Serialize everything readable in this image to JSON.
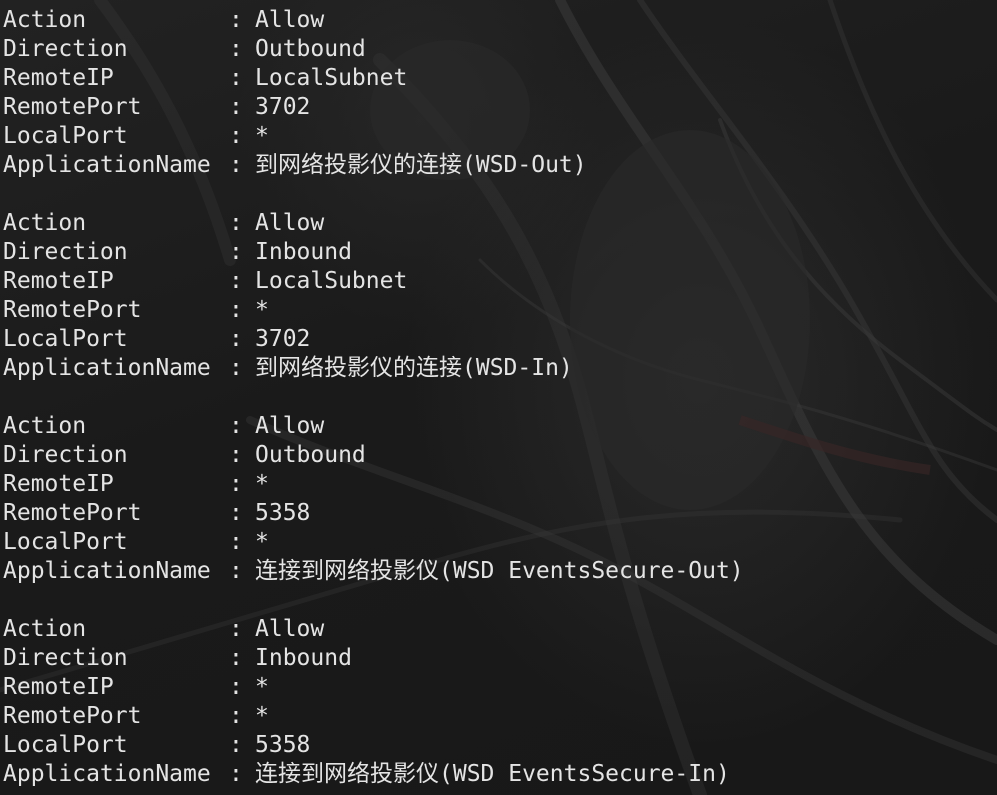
{
  "terminal": {
    "records": [
      {
        "fields": [
          {
            "key": "Action",
            "sep": ":",
            "value": "Allow"
          },
          {
            "key": "Direction",
            "sep": ":",
            "value": "Outbound"
          },
          {
            "key": "RemoteIP",
            "sep": ":",
            "value": "LocalSubnet"
          },
          {
            "key": "RemotePort",
            "sep": ":",
            "value": "3702"
          },
          {
            "key": "LocalPort",
            "sep": ":",
            "value": "*"
          },
          {
            "key": "ApplicationName",
            "sep": ":",
            "value": "到网络投影仪的连接(WSD-Out)"
          }
        ]
      },
      {
        "fields": [
          {
            "key": "Action",
            "sep": ":",
            "value": "Allow"
          },
          {
            "key": "Direction",
            "sep": ":",
            "value": "Inbound"
          },
          {
            "key": "RemoteIP",
            "sep": ":",
            "value": "LocalSubnet"
          },
          {
            "key": "RemotePort",
            "sep": ":",
            "value": "*"
          },
          {
            "key": "LocalPort",
            "sep": ":",
            "value": "3702"
          },
          {
            "key": "ApplicationName",
            "sep": ":",
            "value": "到网络投影仪的连接(WSD-In)"
          }
        ]
      },
      {
        "fields": [
          {
            "key": "Action",
            "sep": ":",
            "value": "Allow"
          },
          {
            "key": "Direction",
            "sep": ":",
            "value": "Outbound"
          },
          {
            "key": "RemoteIP",
            "sep": ":",
            "value": "*"
          },
          {
            "key": "RemotePort",
            "sep": ":",
            "value": "5358"
          },
          {
            "key": "LocalPort",
            "sep": ":",
            "value": "*"
          },
          {
            "key": "ApplicationName",
            "sep": ":",
            "value": "连接到网络投影仪(WSD EventsSecure-Out)"
          }
        ]
      },
      {
        "fields": [
          {
            "key": "Action",
            "sep": ":",
            "value": "Allow"
          },
          {
            "key": "Direction",
            "sep": ":",
            "value": "Inbound"
          },
          {
            "key": "RemoteIP",
            "sep": ":",
            "value": "*"
          },
          {
            "key": "RemotePort",
            "sep": ":",
            "value": "*"
          },
          {
            "key": "LocalPort",
            "sep": ":",
            "value": "5358"
          },
          {
            "key": "ApplicationName",
            "sep": ":",
            "value": "连接到网络投影仪(WSD EventsSecure-In)"
          }
        ]
      }
    ]
  },
  "colors": {
    "background": "#1b1b1b",
    "text": "#e4e4e4"
  }
}
